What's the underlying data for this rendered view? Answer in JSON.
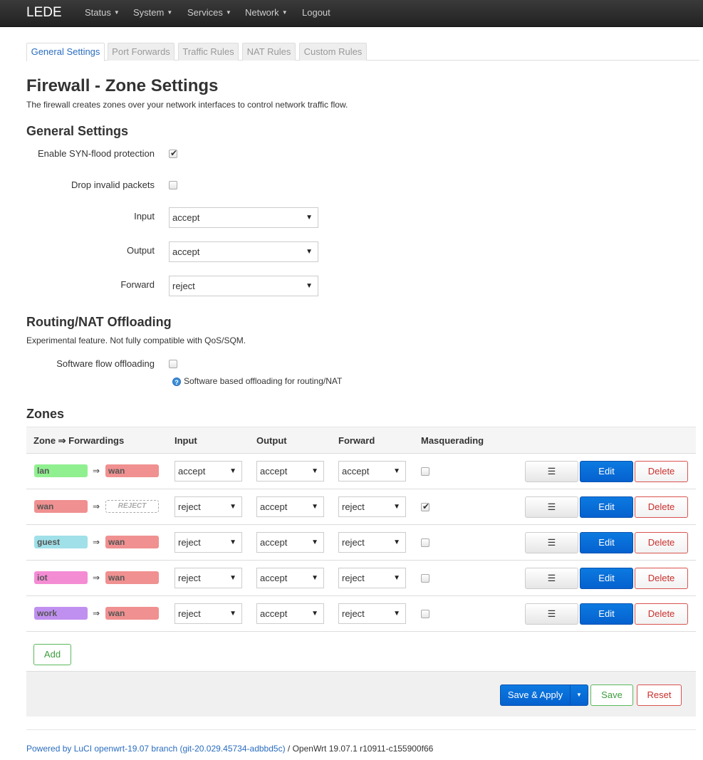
{
  "navbar": {
    "brand": "LEDE",
    "menus": [
      {
        "label": "Status"
      },
      {
        "label": "System"
      },
      {
        "label": "Services"
      },
      {
        "label": "Network"
      }
    ],
    "logout": "Logout"
  },
  "tabs": [
    "General Settings",
    "Port Forwards",
    "Traffic Rules",
    "NAT Rules",
    "Custom Rules"
  ],
  "page": {
    "title": "Firewall - Zone Settings",
    "description": "The firewall creates zones over your network interfaces to control network traffic flow."
  },
  "general": {
    "title": "General Settings",
    "syn_flood_label": "Enable SYN-flood protection",
    "syn_flood_checked": true,
    "drop_invalid_label": "Drop invalid packets",
    "drop_invalid_checked": false,
    "input_label": "Input",
    "input_value": "accept",
    "output_label": "Output",
    "output_value": "accept",
    "forward_label": "Forward",
    "forward_value": "reject"
  },
  "offloading": {
    "title": "Routing/NAT Offloading",
    "description": "Experimental feature. Not fully compatible with QoS/SQM.",
    "sw_label": "Software flow offloading",
    "sw_checked": false,
    "sw_help": "Software based offloading for routing/NAT"
  },
  "zones": {
    "title": "Zones",
    "headers": {
      "zone_forwardings": "Zone ⇒ Forwardings",
      "input": "Input",
      "output": "Output",
      "forward": "Forward",
      "masquerading": "Masquerading"
    },
    "rows": [
      {
        "zone": "lan",
        "forward_to": "wan",
        "forward_reject": false,
        "input": "accept",
        "output": "accept",
        "forward": "accept",
        "masq": false
      },
      {
        "zone": "wan",
        "forward_to": "REJECT",
        "forward_reject": true,
        "input": "reject",
        "output": "accept",
        "forward": "reject",
        "masq": true
      },
      {
        "zone": "guest",
        "forward_to": "wan",
        "forward_reject": false,
        "input": "reject",
        "output": "accept",
        "forward": "reject",
        "masq": false
      },
      {
        "zone": "iot",
        "forward_to": "wan",
        "forward_reject": false,
        "input": "reject",
        "output": "accept",
        "forward": "reject",
        "masq": false
      },
      {
        "zone": "work",
        "forward_to": "wan",
        "forward_reject": false,
        "input": "reject",
        "output": "accept",
        "forward": "reject",
        "masq": false
      }
    ],
    "row_buttons": {
      "sort": "☰",
      "edit": "Edit",
      "delete": "Delete"
    },
    "add_label": "Add"
  },
  "actions": {
    "save_apply": "Save & Apply",
    "save": "Save",
    "reset": "Reset"
  },
  "footer": {
    "powered_by": "Powered by LuCI openwrt-19.07 branch (git-20.029.45734-adbbd5c)",
    "separator": " / ",
    "version": "OpenWrt 19.07.1 r10911-c155900f66"
  },
  "colors": {
    "navbar": "#222222",
    "link": "#2a6dbf",
    "primary": "#0561cf",
    "danger": "#d9534f",
    "success": "#5cb85c",
    "zone_lan": "#90f090",
    "zone_wan": "#f09090",
    "zone_guest": "#a0e0e8",
    "zone_iot": "#f48cd4",
    "zone_work": "#c090f0"
  }
}
